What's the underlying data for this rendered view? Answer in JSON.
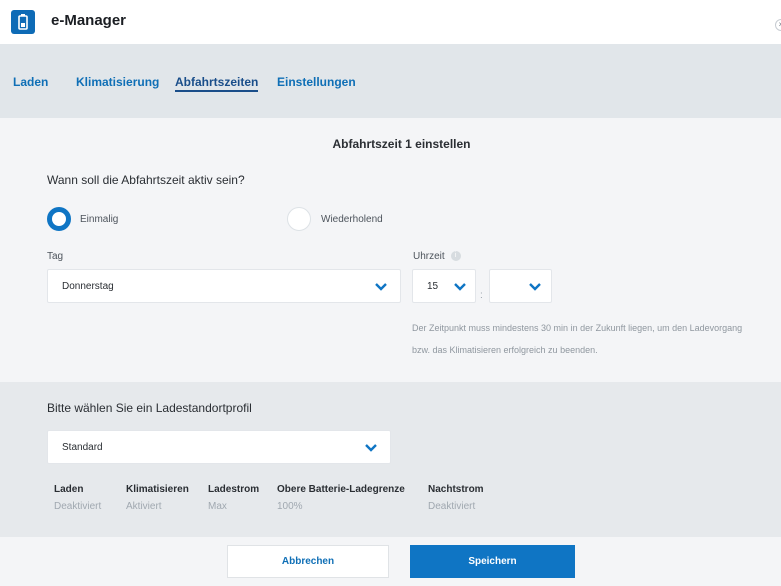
{
  "header": {
    "title": "e-Manager"
  },
  "tabs": [
    {
      "label": "Laden"
    },
    {
      "label": "Klimatisierung"
    },
    {
      "label": "Abfahrtszeiten"
    },
    {
      "label": "Einstellungen"
    }
  ],
  "main": {
    "section_title": "Abfahrtszeit 1 einstellen",
    "question": "Wann soll die Abfahrtszeit aktiv sein?",
    "radio_once": "Einmalig",
    "radio_repeat": "Wiederholend",
    "day_label": "Tag",
    "day_value": "Donnerstag",
    "time_label": "Uhrzeit",
    "hour_value": "15",
    "time_separator": ":",
    "minute_value": "",
    "hint_text": "Der Zeitpunkt muss mindestens 30 min in der Zukunft liegen, um den Ladevorgang bzw. das Klimatisieren erfolgreich zu beenden."
  },
  "profile": {
    "question": "Bitte wählen Sie ein Ladestandortprofil",
    "select_value": "Standard",
    "columns": [
      {
        "header": "Laden",
        "value": "Deaktiviert"
      },
      {
        "header": "Klimatisieren",
        "value": "Aktiviert"
      },
      {
        "header": "Ladestrom",
        "value": "Max"
      },
      {
        "header": "Obere Batterie-Ladegrenze",
        "value": "100%"
      },
      {
        "header": "Nachtstrom",
        "value": "Deaktiviert"
      }
    ]
  },
  "footer": {
    "cancel_label": "Abbrechen",
    "save_label": "Speichern"
  },
  "colors": {
    "accent": "#0f75c4",
    "tab_link": "#0f6fb6",
    "tab_active": "#1a4e8a"
  }
}
